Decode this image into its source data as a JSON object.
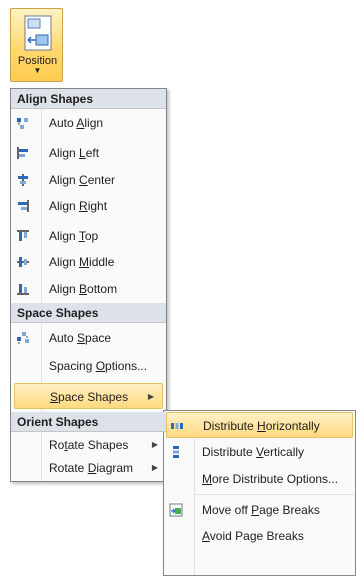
{
  "ribbon": {
    "label": "Position"
  },
  "main_menu": {
    "sections": [
      {
        "title": "Align Shapes",
        "items": [
          {
            "pre": "Auto ",
            "key": "A",
            "post": "lign",
            "icon": "auto-align-icon"
          },
          {
            "pre": "Align ",
            "key": "L",
            "post": "eft",
            "icon": "align-left-icon"
          },
          {
            "pre": "Align ",
            "key": "C",
            "post": "enter",
            "icon": "align-center-icon"
          },
          {
            "pre": "Align ",
            "key": "R",
            "post": "ight",
            "icon": "align-right-icon"
          },
          {
            "pre": "Align ",
            "key": "T",
            "post": "op",
            "icon": "align-top-icon"
          },
          {
            "pre": "Align ",
            "key": "M",
            "post": "iddle",
            "icon": "align-middle-icon"
          },
          {
            "pre": "Align ",
            "key": "B",
            "post": "ottom",
            "icon": "align-bottom-icon"
          }
        ]
      },
      {
        "title": "Space Shapes",
        "items": [
          {
            "pre": "Auto ",
            "key": "S",
            "post": "pace",
            "icon": "auto-space-icon"
          },
          {
            "pre": "Spacing ",
            "key": "O",
            "post": "ptions...",
            "icon": ""
          },
          {
            "pre": "",
            "key": "S",
            "post": "pace Shapes",
            "icon": "",
            "submenu": true,
            "highlighted": true
          }
        ]
      },
      {
        "title": "Orient Shapes",
        "items": [
          {
            "pre": "Ro",
            "key": "t",
            "post": "ate Shapes",
            "icon": "",
            "submenu": true
          },
          {
            "pre": "Rotate ",
            "key": "D",
            "post": "iagram",
            "icon": "",
            "submenu": true
          }
        ]
      }
    ]
  },
  "sub_menu": {
    "items": [
      {
        "pre": "Distribute ",
        "key": "H",
        "post": "orizontally",
        "icon": "distribute-horizontally-icon",
        "highlighted": true
      },
      {
        "pre": "Distribute ",
        "key": "V",
        "post": "ertically",
        "icon": "distribute-vertically-icon"
      },
      {
        "pre": "",
        "key": "M",
        "post": "ore Distribute Options...",
        "icon": ""
      },
      {
        "pre": "Move off ",
        "key": "P",
        "post": "age Breaks",
        "icon": "move-off-page-breaks-icon"
      },
      {
        "pre": "",
        "key": "A",
        "post": "void Page Breaks",
        "icon": ""
      }
    ]
  },
  "colors": {
    "highlight": "#ffd97e",
    "header_bg": "#dde2ea",
    "icon_blue": "#2e68b8"
  }
}
